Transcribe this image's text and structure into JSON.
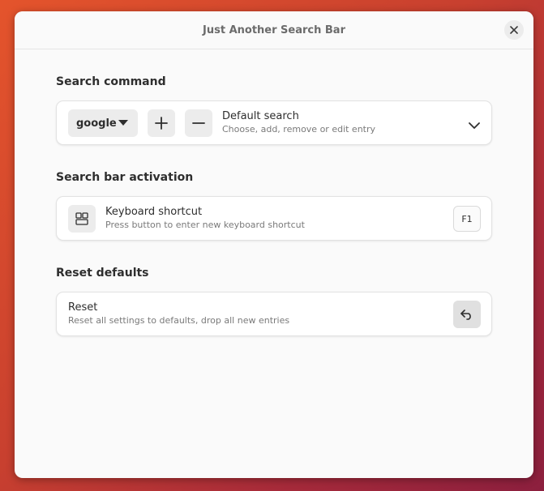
{
  "window": {
    "title": "Just Another Search Bar"
  },
  "sections": {
    "search_command": {
      "title": "Search command",
      "dropdown_value": "google",
      "row_title": "Default search",
      "row_subtitle": "Choose, add, remove or edit entry"
    },
    "activation": {
      "title": "Search bar activation",
      "row_title": "Keyboard shortcut",
      "row_subtitle": "Press button to enter new keyboard shortcut",
      "shortcut_key": "F1"
    },
    "reset": {
      "title": "Reset defaults",
      "row_title": "Reset",
      "row_subtitle": "Reset all settings to defaults, drop all new entries"
    }
  },
  "icons": {
    "close": "close-icon",
    "dropdown": "chevron-down-icon",
    "add": "plus-icon",
    "remove": "minus-icon",
    "expand": "chevron-down-icon",
    "shortcut": "keyboard-shortcut-icon",
    "reset": "undo-icon"
  }
}
